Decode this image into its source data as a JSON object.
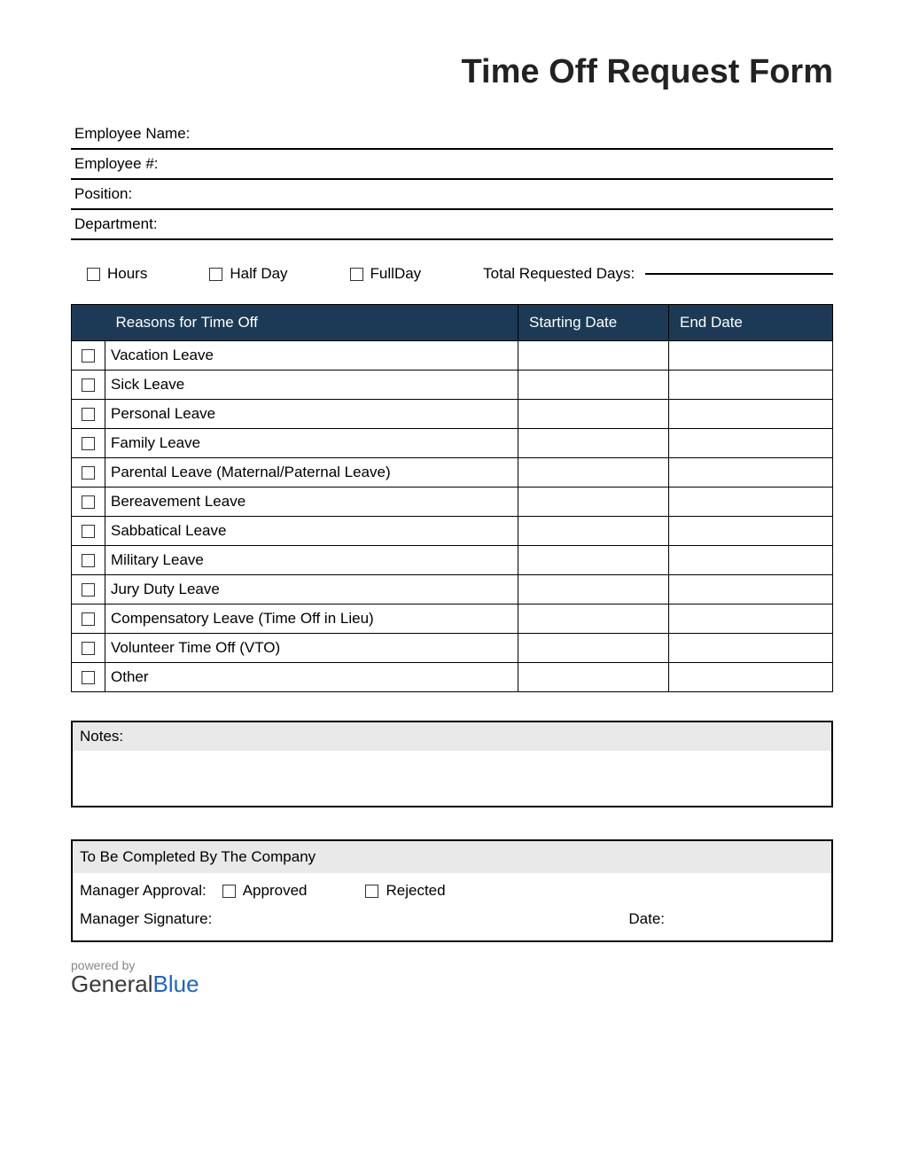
{
  "title": "Time Off Request Form",
  "info": {
    "employee_name_label": "Employee Name:",
    "employee_number_label": "Employee #:",
    "position_label": "Position:",
    "department_label": "Department:"
  },
  "duration": {
    "hours_label": "Hours",
    "half_day_label": "Half Day",
    "full_day_label": "FullDay",
    "total_requested_label": "Total Requested Days:"
  },
  "table": {
    "head_reason": "Reasons for Time Off",
    "head_start": "Starting Date",
    "head_end": "End Date",
    "rows": [
      {
        "label": "Vacation Leave"
      },
      {
        "label": "Sick Leave"
      },
      {
        "label": "Personal Leave"
      },
      {
        "label": "Family Leave"
      },
      {
        "label": "Parental Leave (Maternal/Paternal Leave)"
      },
      {
        "label": "Bereavement Leave"
      },
      {
        "label": "Sabbatical Leave"
      },
      {
        "label": "Military Leave"
      },
      {
        "label": "Jury Duty Leave"
      },
      {
        "label": "Compensatory Leave (Time Off in Lieu)"
      },
      {
        "label": "Volunteer Time Off (VTO)"
      },
      {
        "label": "Other"
      }
    ]
  },
  "notes": {
    "label": "Notes:"
  },
  "company": {
    "header": "To Be Completed By The Company",
    "approval_label": "Manager Approval:",
    "approved_label": "Approved",
    "rejected_label": "Rejected",
    "signature_label": "Manager Signature:",
    "date_label": "Date:"
  },
  "footer": {
    "powered_by": "powered by",
    "brand_a": "General",
    "brand_b": "Blue"
  }
}
